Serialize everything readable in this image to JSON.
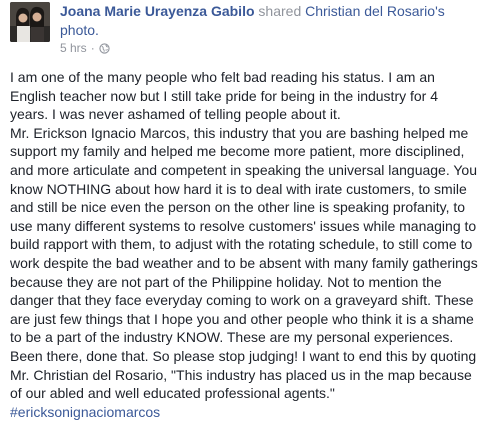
{
  "post": {
    "author": "Joana Marie Urayenza Gabilo",
    "shared_text": " shared ",
    "original_author": "Christian del Rosario's",
    "photo_label": "photo.",
    "timestamp": "5 hrs",
    "separator": "·",
    "privacy_icon": "globe-icon",
    "body_lines": [
      "I am one of the many people who felt bad reading his status. I am an",
      "English teacher now but I still take pride for being in the industry for 4",
      "years. I was never ashamed of telling people about it.",
      "Mr. Erickson Ignacio Marcos, this industry that you are bashing helped me",
      "support my family and helped me become more patient, more disciplined,",
      "and more articulate and competent in speaking the universal language. You",
      "know NOTHING about how hard it is to deal with irate customers, to smile",
      "and still be nice even the person on the other line is speaking profanity, to",
      "use many different systems to resolve customers' issues while managing to",
      "build rapport with them, to adjust with the rotating schedule, to still come to",
      "work despite the bad weather and to be absent with many family gatherings",
      "because they are not part of the Philippine holiday. Not to mention the",
      "danger that they face everyday coming to work on a graveyard shift. These",
      "are just few things that I hope you and other people who think it is a shame",
      "to be a part of the industry KNOW. These are my personal experiences.",
      "Been there, done that. So please stop judging! I want to end this by quoting",
      "Mr. Christian del Rosario, \"This industry has placed us in the map because",
      "of our abled and well educated professional agents.\""
    ],
    "hashtag": "#ericksonignaciomarcos"
  },
  "colors": {
    "link": "#3b5998",
    "meta_gray": "#90949c",
    "text": "#1d2129",
    "background": "#ffffff"
  }
}
